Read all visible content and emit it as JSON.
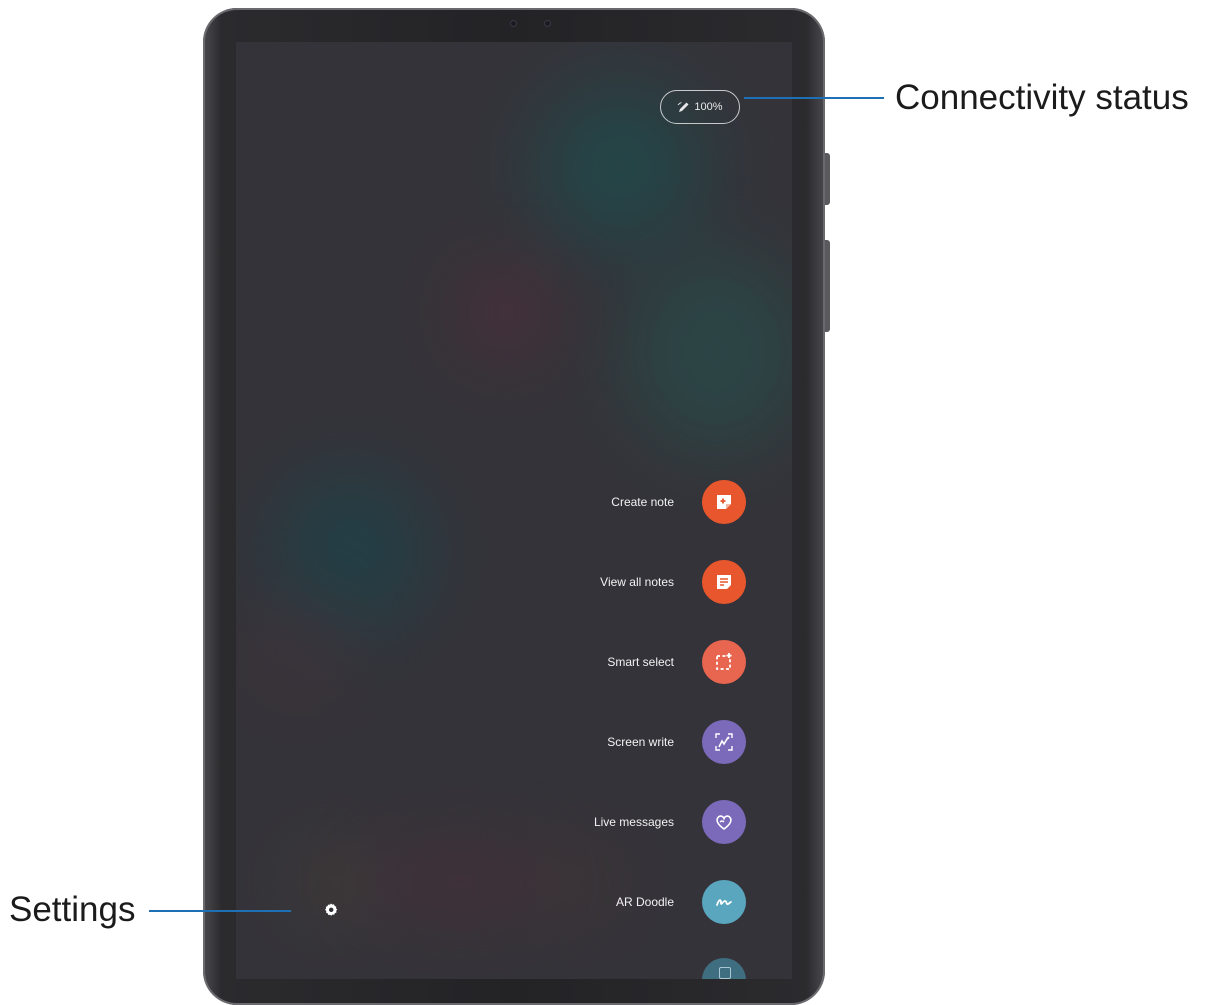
{
  "connectivity": {
    "pen_icon": "pen-icon",
    "value": "100%"
  },
  "menu": {
    "items": [
      {
        "label": "Create note",
        "icon": "create-note-icon",
        "color": "#e8562e"
      },
      {
        "label": "View all notes",
        "icon": "view-all-notes-icon",
        "color": "#e8562e"
      },
      {
        "label": "Smart select",
        "icon": "smart-select-icon",
        "color": "#e86550"
      },
      {
        "label": "Screen write",
        "icon": "screen-write-icon",
        "color": "#7a6ab9"
      },
      {
        "label": "Live messages",
        "icon": "live-messages-icon",
        "color": "#7a6ab9"
      },
      {
        "label": "AR Doodle",
        "icon": "ar-doodle-icon",
        "color": "#5aa6bf"
      }
    ]
  },
  "settings": {
    "icon": "gear-icon"
  },
  "callouts": {
    "connectivity_status": "Connectivity status",
    "settings": "Settings"
  },
  "colors": {
    "callout_line": "#1e6fb4",
    "orange": "#e8562e",
    "purple": "#7a6ab9",
    "teal": "#5aa6bf"
  }
}
